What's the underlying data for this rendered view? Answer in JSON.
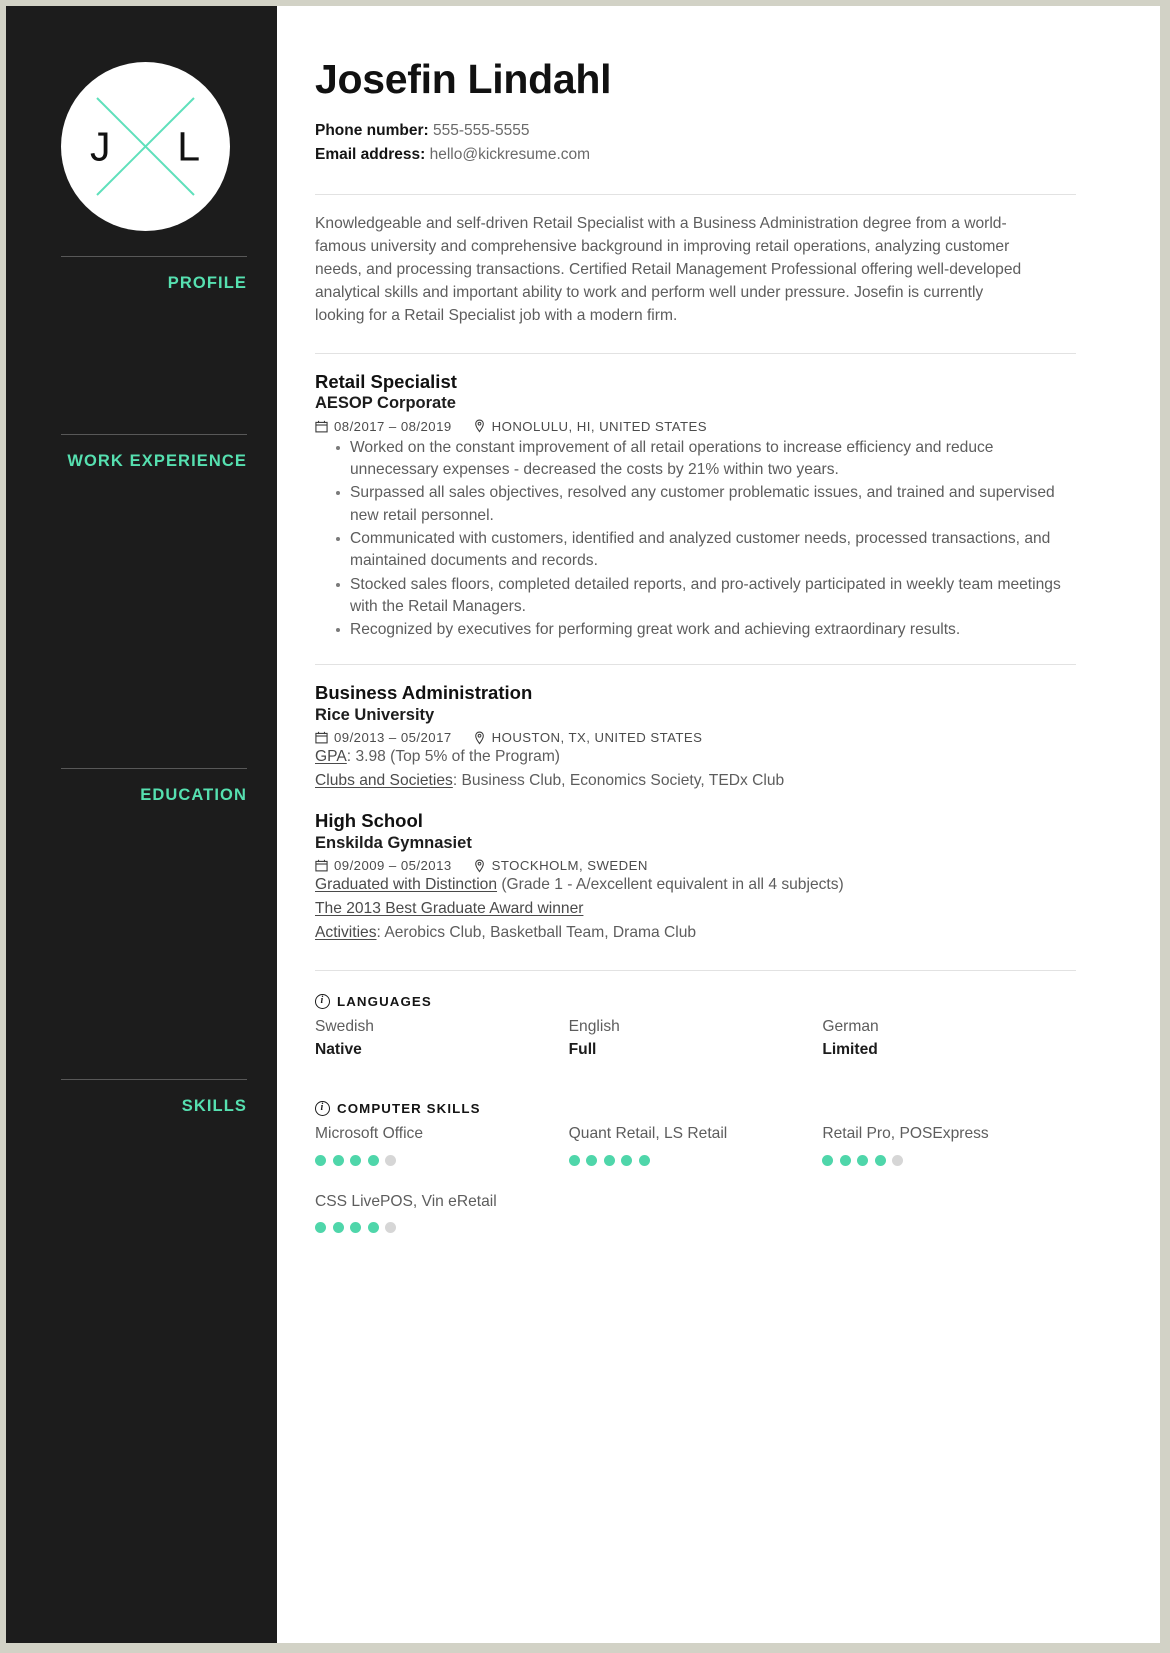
{
  "theme": {
    "accent": "#56e0b0",
    "dot_on": "#4fd6aa",
    "dot_off": "#d6d6d6",
    "sidebar_bg": "#1c1c1c"
  },
  "logo": {
    "initial_first": "J",
    "initial_last": "L"
  },
  "sidebar": {
    "sections": [
      {
        "label": "PROFILE"
      },
      {
        "label": "WORK EXPERIENCE"
      },
      {
        "label": "EDUCATION"
      },
      {
        "label": "SKILLS"
      }
    ]
  },
  "header": {
    "name": "Josefin Lindahl",
    "phone_label": "Phone number:",
    "phone_value": "555-555-5555",
    "email_label": "Email address:",
    "email_value": "hello@kickresume.com"
  },
  "profile": {
    "text": "Knowledgeable and self-driven Retail Specialist with a Business Administration degree from a world-famous university and comprehensive background in improving retail operations, analyzing customer needs, and processing transactions. Certified Retail Management Professional offering well-developed analytical skills and important ability to work and perform well under pressure. Josefin is currently looking for a Retail Specialist job with a modern firm."
  },
  "work": {
    "entries": [
      {
        "title": "Retail Specialist",
        "org": "AESOP Corporate",
        "dates": "08/2017 – 08/2019",
        "location": "HONOLULU, HI, UNITED STATES",
        "bullets": [
          "Worked on the constant improvement of all retail operations to increase efficiency and reduce unnecessary expenses - decreased the costs by 21% within two years.",
          "Surpassed all sales objectives, resolved any customer problematic issues, and trained and supervised new retail personnel.",
          "Communicated with customers, identified and analyzed customer needs, processed transactions, and maintained documents and records.",
          "Stocked sales floors, completed detailed reports, and pro-actively participated in weekly team meetings with the Retail Managers.",
          "Recognized by executives for performing great work and achieving extraordinary results."
        ]
      }
    ]
  },
  "education": {
    "entries": [
      {
        "title": "Business Administration",
        "org": "Rice University",
        "dates": "09/2013 – 05/2017",
        "location": "HOUSTON, TX, UNITED STATES",
        "details": [
          {
            "label": "GPA",
            "sep": ": ",
            "value": "3.98 (Top 5% of the Program)"
          },
          {
            "label": "Clubs and Societies",
            "sep": ": ",
            "value": "Business Club, Economics Society, TEDx Club"
          }
        ]
      },
      {
        "title": "High School",
        "org": "Enskilda Gymnasiet",
        "dates": "09/2009 – 05/2013",
        "location": "STOCKHOLM, SWEDEN",
        "details": [
          {
            "label": "Graduated with Distinction",
            "sep": " ",
            "value": "(Grade 1 - A/excellent equivalent in all 4 subjects)"
          },
          {
            "label": "The 2013 Best Graduate Award winner",
            "sep": "",
            "value": ""
          },
          {
            "label": "Activities",
            "sep": ": ",
            "value": "Aerobics Club, Basketball Team, Drama Club"
          }
        ]
      }
    ]
  },
  "languages": {
    "heading": "LANGUAGES",
    "items": [
      {
        "name": "Swedish",
        "level": "Native"
      },
      {
        "name": "English",
        "level": "Full"
      },
      {
        "name": "German",
        "level": "Limited"
      }
    ]
  },
  "computer_skills": {
    "heading": "COMPUTER SKILLS",
    "max_dots": 5,
    "items": [
      {
        "name": "Microsoft Office",
        "rating": 4
      },
      {
        "name": "Quant Retail, LS Retail",
        "rating": 5
      },
      {
        "name": "Retail Pro, POSExpress",
        "rating": 4
      },
      {
        "name": "CSS LivePOS, Vin eRetail",
        "rating": 4
      }
    ]
  }
}
